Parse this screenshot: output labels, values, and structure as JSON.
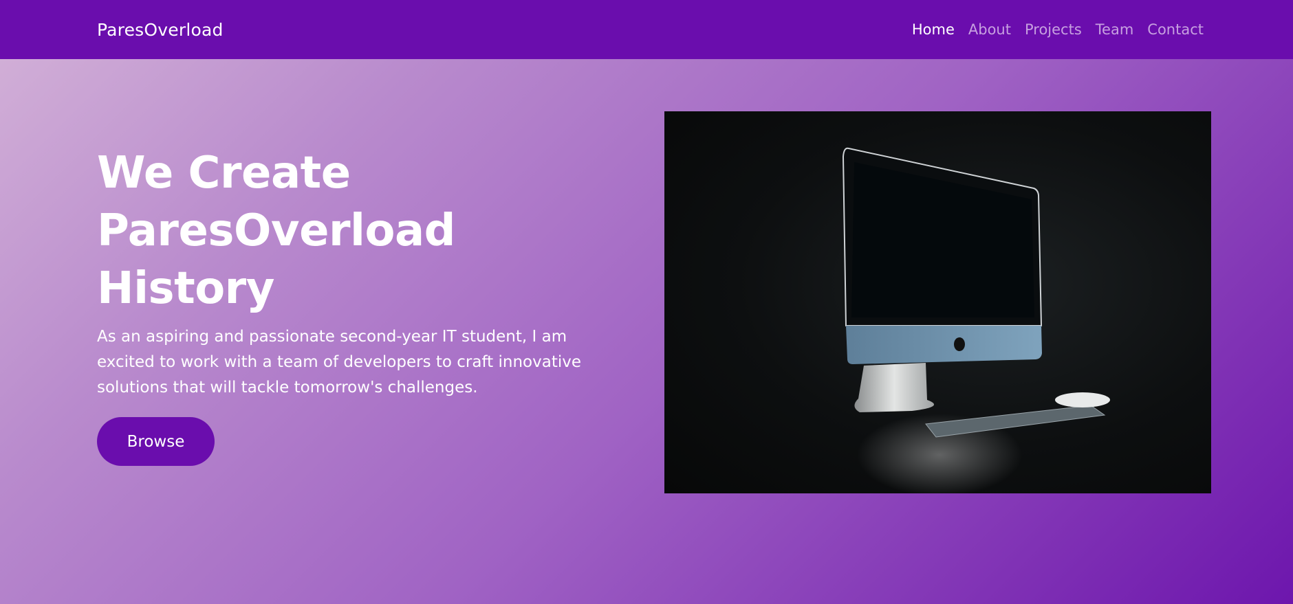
{
  "navbar": {
    "brand": "ParesOverload",
    "links": [
      {
        "label": "Home",
        "active": true
      },
      {
        "label": "About",
        "active": false
      },
      {
        "label": "Projects",
        "active": false
      },
      {
        "label": "Team",
        "active": false
      },
      {
        "label": "Contact",
        "active": false
      }
    ]
  },
  "hero": {
    "title_lines": [
      "We Create",
      "ParesOverload",
      "History"
    ],
    "description": "As an aspiring and passionate second-year IT student, I am excited to work with a team of developers to craft innovative solutions that will tackle tomorrow's challenges.",
    "button_label": "Browse",
    "image_icon": "desktop-computer-photo"
  },
  "colors": {
    "primary": "#6a0dad",
    "nav_inactive": "#c7a0e0",
    "text": "#ffffff"
  }
}
